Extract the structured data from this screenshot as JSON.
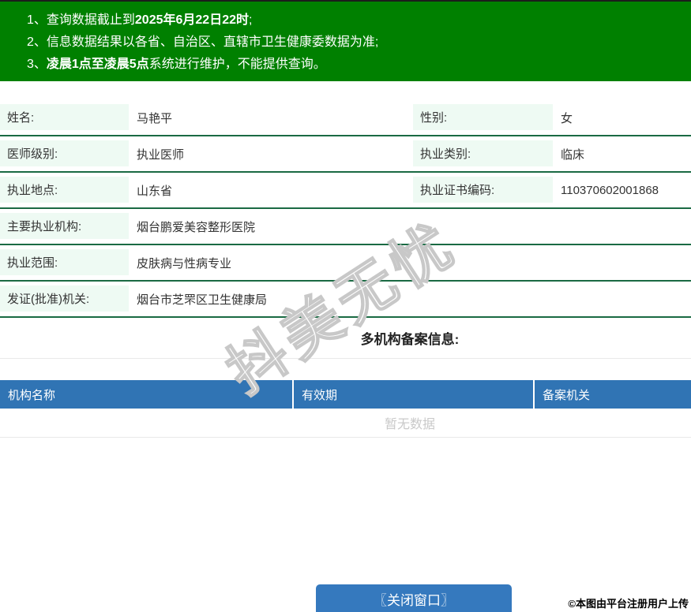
{
  "notice": {
    "lines": [
      {
        "pre": "1、查询数据截止到",
        "bold": "2025年6月22日22时",
        "post": ";"
      },
      {
        "pre": "2、信息数据结果以各省、自治区、直辖市卫生健康委数据为准;",
        "bold": "",
        "post": ""
      },
      {
        "pre": "3、",
        "bold": "凌晨1点至凌晨5点",
        "post": "系统进行维护，不能提供查询。"
      }
    ]
  },
  "fields": {
    "rows": [
      {
        "label": "姓名:",
        "value": "马艳平",
        "label2": "性别:",
        "value2": "女"
      },
      {
        "label": "医师级别:",
        "value": "执业医师",
        "label2": "执业类别:",
        "value2": "临床"
      },
      {
        "label": "执业地点:",
        "value": "山东省",
        "label2": "执业证书编码:",
        "value2": "110370602001868"
      },
      {
        "label": "主要执业机构:",
        "value": "烟台鹏爱美容整形医院"
      },
      {
        "label": "执业范围:",
        "value": "皮肤病与性病专业"
      },
      {
        "label": "发证(批准)机关:",
        "value": "烟台市芝罘区卫生健康局"
      }
    ]
  },
  "section": {
    "title": "多机构备案信息:"
  },
  "org_table": {
    "headers": [
      "机构名称",
      "有效期",
      "备案机关"
    ],
    "empty_text": "暂无数据"
  },
  "footer": {
    "close_button": "〖关闭窗口〗",
    "credit": "©本图由平台注册用户上传"
  },
  "watermark": {
    "text": "抖美无忧"
  },
  "colors": {
    "header_green": "#008000",
    "label_bg": "#eefaf3",
    "row_divider": "#1a6a43",
    "table_header_blue": "#3074b4",
    "button_blue": "#3579be"
  }
}
